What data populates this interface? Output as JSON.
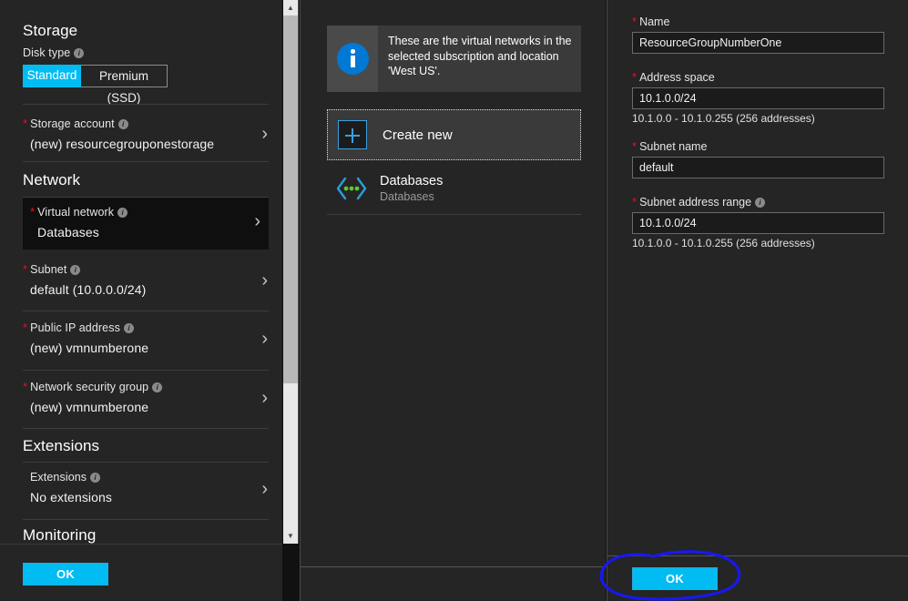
{
  "left_blade": {
    "sections": [
      {
        "title": "Storage",
        "rows": [
          {
            "kind": "toggle",
            "label": "Disk type",
            "has_info": true,
            "options": [
              "Standard",
              "Premium (SSD)"
            ],
            "selected": "Standard"
          },
          {
            "kind": "nav",
            "label": "Storage account",
            "required": true,
            "has_info": true,
            "value": "(new) resourcegrouponestorage",
            "chevron": "›"
          }
        ]
      },
      {
        "title": "Network",
        "rows": [
          {
            "kind": "nav",
            "label": "Virtual network",
            "required": true,
            "has_info": true,
            "value": "Databases",
            "selected": true,
            "chevron": "›"
          },
          {
            "kind": "nav",
            "label": "Subnet",
            "required": true,
            "has_info": true,
            "value": "default (10.0.0.0/24)",
            "chevron": "›"
          },
          {
            "kind": "nav",
            "label": "Public IP address",
            "required": true,
            "has_info": true,
            "value": "(new) vmnumberone",
            "chevron": "›"
          },
          {
            "kind": "nav",
            "label": "Network security group",
            "required": true,
            "has_info": true,
            "value": "(new) vmnumberone",
            "chevron": "›"
          }
        ]
      },
      {
        "title": "Extensions",
        "rows": [
          {
            "kind": "nav",
            "label": "Extensions",
            "required": false,
            "has_info": true,
            "value": "No extensions",
            "chevron": "›"
          }
        ]
      },
      {
        "title": "Monitoring",
        "rows": []
      }
    ],
    "footer": {
      "ok_label": "OK"
    },
    "scrollbar": {
      "up_arrow": "▲",
      "down_arrow": "▼"
    }
  },
  "middle_blade": {
    "info_message": "These are the virtual networks in the selected subscription and location 'West US'.",
    "info_icon": "info-icon",
    "create_new": {
      "label": "Create new",
      "icon": "plus-icon"
    },
    "list_items": [
      {
        "title": "Databases",
        "subtitle": "Databases",
        "icon": "virtual-network-icon"
      }
    ]
  },
  "right_blade": {
    "fields": [
      {
        "label": "Name",
        "required": true,
        "has_info": false,
        "value": "ResourceGroupNumberOne",
        "hint": ""
      },
      {
        "label": "Address space",
        "required": true,
        "has_info": false,
        "value": "10.1.0.0/24",
        "hint": "10.1.0.0 - 10.1.0.255 (256 addresses)"
      },
      {
        "label": "Subnet name",
        "required": true,
        "has_info": false,
        "value": "default",
        "hint": ""
      },
      {
        "label": "Subnet address range",
        "required": true,
        "has_info": true,
        "value": "10.1.0.0/24",
        "hint": "10.1.0.0 - 10.1.0.255 (256 addresses)"
      }
    ],
    "footer": {
      "ok_label": "OK"
    }
  },
  "annotation": {
    "shape": "hand-drawn-ellipse",
    "color": "#1818f0",
    "target": "ok-button"
  },
  "colors": {
    "accent": "#00bcf2",
    "info_blue": "#0078d4",
    "required_red": "#e81123",
    "blade_bg": "#252525",
    "selected_row": "#0f0f0f",
    "vnet_icon_blue": "#2e9bd6",
    "vnet_icon_green": "#5ec72e"
  }
}
